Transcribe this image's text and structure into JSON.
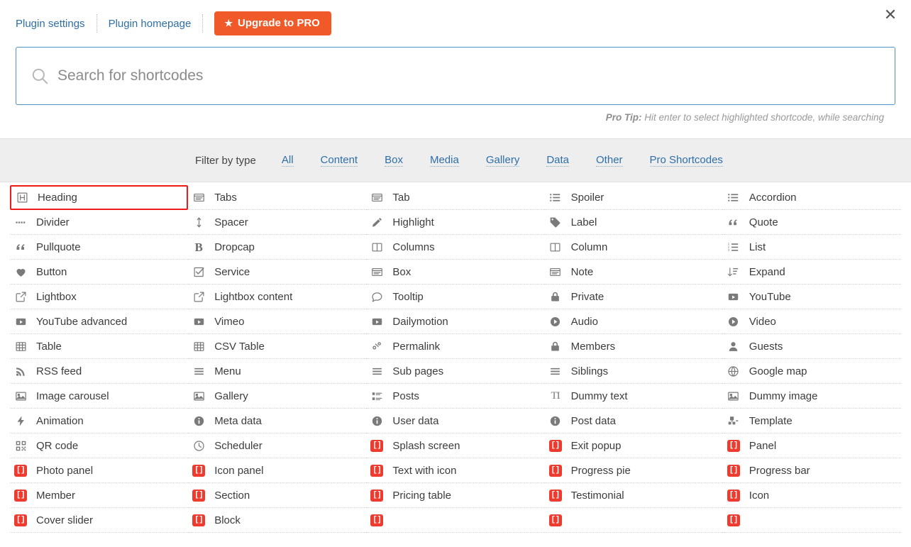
{
  "topbar": {
    "links": [
      {
        "label": "Plugin settings",
        "name": "plugin-settings-link"
      },
      {
        "label": "Plugin homepage",
        "name": "plugin-homepage-link"
      }
    ],
    "upgrade_button": "Upgrade to PRO",
    "upgrade_star": "★",
    "close_label": "✕",
    "accent_color": "#f05a28",
    "link_color": "#2e6fa8"
  },
  "search": {
    "placeholder": "Search for shortcodes",
    "value": "",
    "border_color": "#4f94cd",
    "protip_bold": "Pro Tip:",
    "protip_text": " Hit enter to select highlighted shortcode, while searching"
  },
  "filter": {
    "label": "Filter by type",
    "options": [
      "All",
      "Content",
      "Box",
      "Media",
      "Gallery",
      "Data",
      "Other",
      "Pro Shortcodes"
    ],
    "background": "#eeeeee"
  },
  "selection": {
    "selected_item": "Heading",
    "highlight_color": "#ef1a1a"
  },
  "grid": {
    "columns": 5,
    "pro_icon_color": "#ee3b2f",
    "items": [
      {
        "label": "Heading",
        "icon": "heading-icon",
        "pro": false,
        "selected": true
      },
      {
        "label": "Tabs",
        "icon": "tabs-icon",
        "pro": false
      },
      {
        "label": "Tab",
        "icon": "tab-icon",
        "pro": false
      },
      {
        "label": "Spoiler",
        "icon": "spoiler-list-icon",
        "pro": false
      },
      {
        "label": "Accordion",
        "icon": "accordion-list-icon",
        "pro": false
      },
      {
        "label": "Divider",
        "icon": "divider-dots-icon",
        "pro": false
      },
      {
        "label": "Spacer",
        "icon": "spacer-arrows-icon",
        "pro": false
      },
      {
        "label": "Highlight",
        "icon": "pencil-icon",
        "pro": false
      },
      {
        "label": "Label",
        "icon": "tag-icon",
        "pro": false
      },
      {
        "label": "Quote",
        "icon": "quote-icon",
        "pro": false
      },
      {
        "label": "Pullquote",
        "icon": "pullquote-icon",
        "pro": false
      },
      {
        "label": "Dropcap",
        "icon": "bold-b-icon",
        "pro": false
      },
      {
        "label": "Columns",
        "icon": "columns-icon",
        "pro": false
      },
      {
        "label": "Column",
        "icon": "column-icon",
        "pro": false
      },
      {
        "label": "List",
        "icon": "ordered-list-icon",
        "pro": false
      },
      {
        "label": "Button",
        "icon": "heart-icon",
        "pro": false
      },
      {
        "label": "Service",
        "icon": "check-square-icon",
        "pro": false
      },
      {
        "label": "Box",
        "icon": "box-icon",
        "pro": false
      },
      {
        "label": "Note",
        "icon": "note-icon",
        "pro": false
      },
      {
        "label": "Expand",
        "icon": "sort-expand-icon",
        "pro": false
      },
      {
        "label": "Lightbox",
        "icon": "external-link-icon",
        "pro": false
      },
      {
        "label": "Lightbox content",
        "icon": "external-link-icon",
        "pro": false
      },
      {
        "label": "Tooltip",
        "icon": "speech-bubble-icon",
        "pro": false
      },
      {
        "label": "Private",
        "icon": "lock-icon",
        "pro": false
      },
      {
        "label": "YouTube",
        "icon": "youtube-icon",
        "pro": false
      },
      {
        "label": "YouTube advanced",
        "icon": "youtube-icon",
        "pro": false
      },
      {
        "label": "Vimeo",
        "icon": "youtube-icon",
        "pro": false
      },
      {
        "label": "Dailymotion",
        "icon": "youtube-icon",
        "pro": false
      },
      {
        "label": "Audio",
        "icon": "play-circle-icon",
        "pro": false
      },
      {
        "label": "Video",
        "icon": "play-circle-icon",
        "pro": false
      },
      {
        "label": "Table",
        "icon": "table-grid-icon",
        "pro": false
      },
      {
        "label": "CSV Table",
        "icon": "table-grid-icon",
        "pro": false
      },
      {
        "label": "Permalink",
        "icon": "link-chain-icon",
        "pro": false
      },
      {
        "label": "Members",
        "icon": "lock-icon",
        "pro": false
      },
      {
        "label": "Guests",
        "icon": "user-icon",
        "pro": false
      },
      {
        "label": "RSS feed",
        "icon": "rss-icon",
        "pro": false
      },
      {
        "label": "Menu",
        "icon": "hamburger-icon",
        "pro": false
      },
      {
        "label": "Sub pages",
        "icon": "hamburger-icon",
        "pro": false
      },
      {
        "label": "Siblings",
        "icon": "hamburger-icon",
        "pro": false
      },
      {
        "label": "Google map",
        "icon": "globe-icon",
        "pro": false
      },
      {
        "label": "Image carousel",
        "icon": "image-icon",
        "pro": false
      },
      {
        "label": "Gallery",
        "icon": "image-icon",
        "pro": false
      },
      {
        "label": "Posts",
        "icon": "posts-list-icon",
        "pro": false
      },
      {
        "label": "Dummy text",
        "icon": "text-type-icon",
        "pro": false
      },
      {
        "label": "Dummy image",
        "icon": "image-icon",
        "pro": false
      },
      {
        "label": "Animation",
        "icon": "bolt-icon",
        "pro": false
      },
      {
        "label": "Meta data",
        "icon": "info-circle-icon",
        "pro": false
      },
      {
        "label": "User data",
        "icon": "info-circle-icon",
        "pro": false
      },
      {
        "label": "Post data",
        "icon": "info-circle-icon",
        "pro": false
      },
      {
        "label": "Template",
        "icon": "template-icon",
        "pro": false
      },
      {
        "label": "QR code",
        "icon": "qr-code-icon",
        "pro": false
      },
      {
        "label": "Scheduler",
        "icon": "clock-icon",
        "pro": false
      },
      {
        "label": "Splash screen",
        "icon": "shortcode-pro-icon",
        "pro": true
      },
      {
        "label": "Exit popup",
        "icon": "shortcode-pro-icon",
        "pro": true
      },
      {
        "label": "Panel",
        "icon": "shortcode-pro-icon",
        "pro": true
      },
      {
        "label": "Photo panel",
        "icon": "shortcode-pro-icon",
        "pro": true
      },
      {
        "label": "Icon panel",
        "icon": "shortcode-pro-icon",
        "pro": true
      },
      {
        "label": "Text with icon",
        "icon": "shortcode-pro-icon",
        "pro": true
      },
      {
        "label": "Progress pie",
        "icon": "shortcode-pro-icon",
        "pro": true
      },
      {
        "label": "Progress bar",
        "icon": "shortcode-pro-icon",
        "pro": true
      },
      {
        "label": "Member",
        "icon": "shortcode-pro-icon",
        "pro": true
      },
      {
        "label": "Section",
        "icon": "shortcode-pro-icon",
        "pro": true
      },
      {
        "label": "Pricing table",
        "icon": "shortcode-pro-icon",
        "pro": true
      },
      {
        "label": "Testimonial",
        "icon": "shortcode-pro-icon",
        "pro": true
      },
      {
        "label": "Icon",
        "icon": "shortcode-pro-icon",
        "pro": true
      },
      {
        "label": "Cover slider",
        "icon": "shortcode-pro-icon",
        "pro": true
      },
      {
        "label": "Block",
        "icon": "shortcode-pro-icon",
        "pro": true
      },
      {
        "label": "",
        "icon": "shortcode-pro-icon",
        "pro": true
      },
      {
        "label": "",
        "icon": "shortcode-pro-icon",
        "pro": true
      },
      {
        "label": "",
        "icon": "shortcode-pro-icon",
        "pro": true
      }
    ]
  }
}
